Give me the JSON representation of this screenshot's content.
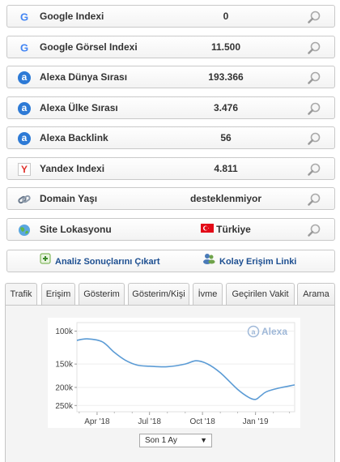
{
  "rows": [
    {
      "label": "Google Indexi",
      "value": "0",
      "icon": "google-icon"
    },
    {
      "label": "Google Görsel Indexi",
      "value": "11.500",
      "icon": "google-icon"
    },
    {
      "label": "Alexa Dünya Sırası",
      "value": "193.366",
      "icon": "alexa-icon"
    },
    {
      "label": "Alexa Ülke Sırası",
      "value": "3.476",
      "icon": "alexa-icon"
    },
    {
      "label": "Alexa Backlink",
      "value": "56",
      "icon": "alexa-icon"
    },
    {
      "label": "Yandex Indexi",
      "value": "4.811",
      "icon": "yandex-icon"
    },
    {
      "label": "Domain Yaşı",
      "value": "desteklenmiyor",
      "icon": "link-icon"
    },
    {
      "label": "Site Lokasyonu",
      "value": "Türkiye",
      "icon": "globe-icon"
    }
  ],
  "actions": {
    "export_label": "Analiz Sonuçlarını Çıkart",
    "easy_access_label": "Kolay Erişim Linki"
  },
  "tabs": [
    "Trafik",
    "Erişim",
    "Gösterim",
    "Gösterim/Kişi",
    "İvme",
    "Geçirilen Vakit",
    "Arama"
  ],
  "active_tab": "Trafik",
  "chart_logo_text": "Alexa",
  "period": {
    "selected": "Son 1 Ay"
  },
  "colors": {
    "line": "#5b9bd5",
    "alexa_blue": "#2d7ad6",
    "flag_red": "#e30a17"
  },
  "chart_data": {
    "type": "line",
    "title": "",
    "xlabel": "",
    "ylabel": "",
    "y_axis": "reversed-log",
    "y_ticks": [
      "100k",
      "150k",
      "200k",
      "250k"
    ],
    "y_tick_values": [
      100000,
      150000,
      200000,
      250000
    ],
    "x_ticks": [
      "Apr '18",
      "Jul '18",
      "Oct '18",
      "Jan '19"
    ],
    "x_tick_dates": [
      "2018-04-01",
      "2018-07-01",
      "2018-10-01",
      "2019-01-01"
    ],
    "ylim": [
      90000,
      270000
    ],
    "xlim": [
      "2018-02-25",
      "2019-03-10"
    ],
    "series": [
      {
        "points": [
          [
            "2018-02-25",
            112000
          ],
          [
            "2018-03-15",
            110000
          ],
          [
            "2018-04-10",
            114000
          ],
          [
            "2018-05-01",
            130000
          ],
          [
            "2018-05-20",
            143000
          ],
          [
            "2018-06-10",
            152000
          ],
          [
            "2018-07-01",
            154000
          ],
          [
            "2018-08-01",
            155000
          ],
          [
            "2018-09-01",
            150000
          ],
          [
            "2018-09-20",
            144000
          ],
          [
            "2018-10-10",
            150000
          ],
          [
            "2018-11-01",
            167000
          ],
          [
            "2018-12-01",
            205000
          ],
          [
            "2018-12-20",
            226000
          ],
          [
            "2019-01-01",
            232000
          ],
          [
            "2019-01-10",
            222000
          ],
          [
            "2019-01-20",
            211000
          ],
          [
            "2019-02-10",
            202000
          ],
          [
            "2019-03-10",
            194000
          ]
        ]
      }
    ]
  }
}
